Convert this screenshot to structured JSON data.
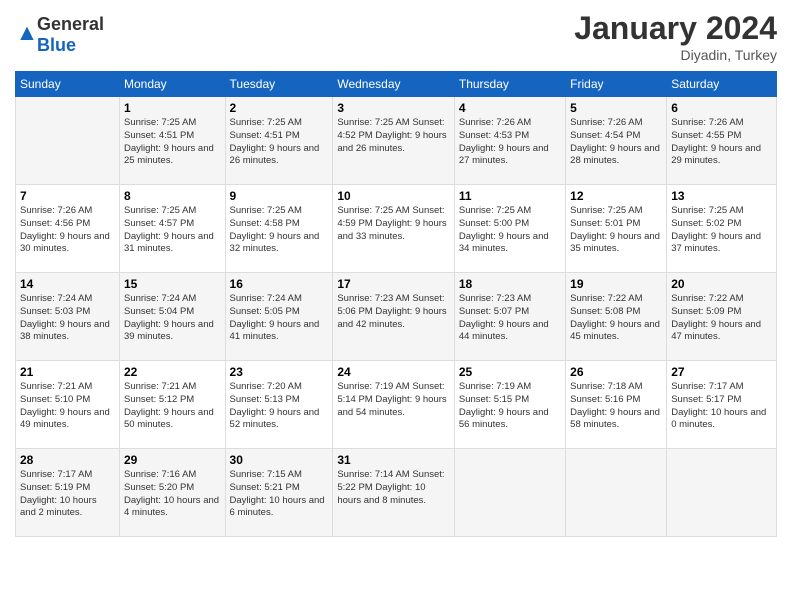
{
  "header": {
    "logo_general": "General",
    "logo_blue": "Blue",
    "month": "January 2024",
    "location": "Diyadin, Turkey"
  },
  "days_of_week": [
    "Sunday",
    "Monday",
    "Tuesday",
    "Wednesday",
    "Thursday",
    "Friday",
    "Saturday"
  ],
  "weeks": [
    [
      {
        "day": "",
        "info": ""
      },
      {
        "day": "1",
        "info": "Sunrise: 7:25 AM\nSunset: 4:51 PM\nDaylight: 9 hours\nand 25 minutes."
      },
      {
        "day": "2",
        "info": "Sunrise: 7:25 AM\nSunset: 4:51 PM\nDaylight: 9 hours\nand 26 minutes."
      },
      {
        "day": "3",
        "info": "Sunrise: 7:25 AM\nSunset: 4:52 PM\nDaylight: 9 hours\nand 26 minutes."
      },
      {
        "day": "4",
        "info": "Sunrise: 7:26 AM\nSunset: 4:53 PM\nDaylight: 9 hours\nand 27 minutes."
      },
      {
        "day": "5",
        "info": "Sunrise: 7:26 AM\nSunset: 4:54 PM\nDaylight: 9 hours\nand 28 minutes."
      },
      {
        "day": "6",
        "info": "Sunrise: 7:26 AM\nSunset: 4:55 PM\nDaylight: 9 hours\nand 29 minutes."
      }
    ],
    [
      {
        "day": "7",
        "info": "Sunrise: 7:26 AM\nSunset: 4:56 PM\nDaylight: 9 hours\nand 30 minutes."
      },
      {
        "day": "8",
        "info": "Sunrise: 7:25 AM\nSunset: 4:57 PM\nDaylight: 9 hours\nand 31 minutes."
      },
      {
        "day": "9",
        "info": "Sunrise: 7:25 AM\nSunset: 4:58 PM\nDaylight: 9 hours\nand 32 minutes."
      },
      {
        "day": "10",
        "info": "Sunrise: 7:25 AM\nSunset: 4:59 PM\nDaylight: 9 hours\nand 33 minutes."
      },
      {
        "day": "11",
        "info": "Sunrise: 7:25 AM\nSunset: 5:00 PM\nDaylight: 9 hours\nand 34 minutes."
      },
      {
        "day": "12",
        "info": "Sunrise: 7:25 AM\nSunset: 5:01 PM\nDaylight: 9 hours\nand 35 minutes."
      },
      {
        "day": "13",
        "info": "Sunrise: 7:25 AM\nSunset: 5:02 PM\nDaylight: 9 hours\nand 37 minutes."
      }
    ],
    [
      {
        "day": "14",
        "info": "Sunrise: 7:24 AM\nSunset: 5:03 PM\nDaylight: 9 hours\nand 38 minutes."
      },
      {
        "day": "15",
        "info": "Sunrise: 7:24 AM\nSunset: 5:04 PM\nDaylight: 9 hours\nand 39 minutes."
      },
      {
        "day": "16",
        "info": "Sunrise: 7:24 AM\nSunset: 5:05 PM\nDaylight: 9 hours\nand 41 minutes."
      },
      {
        "day": "17",
        "info": "Sunrise: 7:23 AM\nSunset: 5:06 PM\nDaylight: 9 hours\nand 42 minutes."
      },
      {
        "day": "18",
        "info": "Sunrise: 7:23 AM\nSunset: 5:07 PM\nDaylight: 9 hours\nand 44 minutes."
      },
      {
        "day": "19",
        "info": "Sunrise: 7:22 AM\nSunset: 5:08 PM\nDaylight: 9 hours\nand 45 minutes."
      },
      {
        "day": "20",
        "info": "Sunrise: 7:22 AM\nSunset: 5:09 PM\nDaylight: 9 hours\nand 47 minutes."
      }
    ],
    [
      {
        "day": "21",
        "info": "Sunrise: 7:21 AM\nSunset: 5:10 PM\nDaylight: 9 hours\nand 49 minutes."
      },
      {
        "day": "22",
        "info": "Sunrise: 7:21 AM\nSunset: 5:12 PM\nDaylight: 9 hours\nand 50 minutes."
      },
      {
        "day": "23",
        "info": "Sunrise: 7:20 AM\nSunset: 5:13 PM\nDaylight: 9 hours\nand 52 minutes."
      },
      {
        "day": "24",
        "info": "Sunrise: 7:19 AM\nSunset: 5:14 PM\nDaylight: 9 hours\nand 54 minutes."
      },
      {
        "day": "25",
        "info": "Sunrise: 7:19 AM\nSunset: 5:15 PM\nDaylight: 9 hours\nand 56 minutes."
      },
      {
        "day": "26",
        "info": "Sunrise: 7:18 AM\nSunset: 5:16 PM\nDaylight: 9 hours\nand 58 minutes."
      },
      {
        "day": "27",
        "info": "Sunrise: 7:17 AM\nSunset: 5:17 PM\nDaylight: 10 hours\nand 0 minutes."
      }
    ],
    [
      {
        "day": "28",
        "info": "Sunrise: 7:17 AM\nSunset: 5:19 PM\nDaylight: 10 hours\nand 2 minutes."
      },
      {
        "day": "29",
        "info": "Sunrise: 7:16 AM\nSunset: 5:20 PM\nDaylight: 10 hours\nand 4 minutes."
      },
      {
        "day": "30",
        "info": "Sunrise: 7:15 AM\nSunset: 5:21 PM\nDaylight: 10 hours\nand 6 minutes."
      },
      {
        "day": "31",
        "info": "Sunrise: 7:14 AM\nSunset: 5:22 PM\nDaylight: 10 hours\nand 8 minutes."
      },
      {
        "day": "",
        "info": ""
      },
      {
        "day": "",
        "info": ""
      },
      {
        "day": "",
        "info": ""
      }
    ]
  ]
}
